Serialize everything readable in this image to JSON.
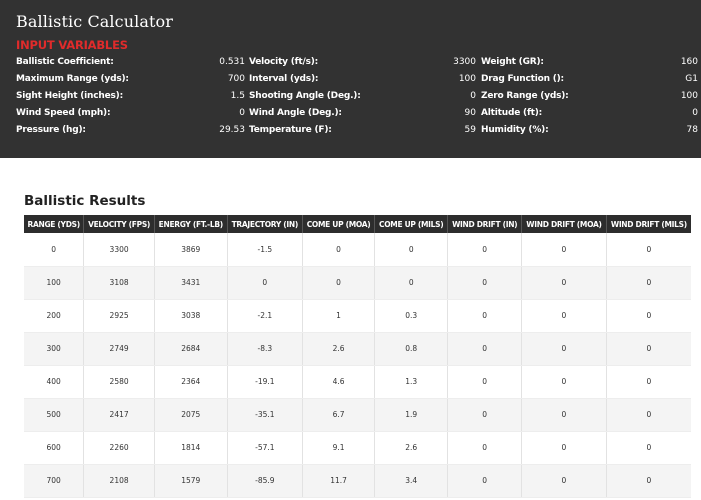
{
  "app": {
    "title": "Ballistic Calculator"
  },
  "inputs": {
    "section_title": "INPUT VARIABLES",
    "columns": [
      [
        {
          "label": "Ballistic Coefficient:",
          "value": "0.531"
        },
        {
          "label": "Maximum Range (yds):",
          "value": "700"
        },
        {
          "label": "Sight Height (inches):",
          "value": "1.5"
        },
        {
          "label": "Wind Speed (mph):",
          "value": "0"
        },
        {
          "label": "Pressure (hg):",
          "value": "29.53"
        }
      ],
      [
        {
          "label": "Velocity (ft/s):",
          "value": "3300"
        },
        {
          "label": "Interval (yds):",
          "value": "100"
        },
        {
          "label": "Shooting Angle (Deg.):",
          "value": "0"
        },
        {
          "label": "Wind Angle (Deg.):",
          "value": "90"
        },
        {
          "label": "Temperature (F):",
          "value": "59"
        }
      ],
      [
        {
          "label": "Weight (GR):",
          "value": "160"
        },
        {
          "label": "Drag Function ():",
          "value": "G1"
        },
        {
          "label": "Zero Range (yds):",
          "value": "100"
        },
        {
          "label": "Altitude (ft):",
          "value": "0"
        },
        {
          "label": "Humidity (%):",
          "value": "78"
        }
      ]
    ]
  },
  "results": {
    "title": "Ballistic Results",
    "headers": [
      "RANGE (YDS)",
      "VELOCITY (FPS)",
      "ENERGY (FT.-LB)",
      "TRAJECTORY (IN)",
      "COME UP (MOA)",
      "COME UP (MILS)",
      "WIND DRIFT (IN)",
      "WIND DRIFT (MOA)",
      "WIND DRIFT (MILS)"
    ],
    "rows": [
      [
        "0",
        "3300",
        "3869",
        "-1.5",
        "0",
        "0",
        "0",
        "0",
        "0"
      ],
      [
        "100",
        "3108",
        "3431",
        "0",
        "0",
        "0",
        "0",
        "0",
        "0"
      ],
      [
        "200",
        "2925",
        "3038",
        "-2.1",
        "1",
        "0.3",
        "0",
        "0",
        "0"
      ],
      [
        "300",
        "2749",
        "2684",
        "-8.3",
        "2.6",
        "0.8",
        "0",
        "0",
        "0"
      ],
      [
        "400",
        "2580",
        "2364",
        "-19.1",
        "4.6",
        "1.3",
        "0",
        "0",
        "0"
      ],
      [
        "500",
        "2417",
        "2075",
        "-35.1",
        "6.7",
        "1.9",
        "0",
        "0",
        "0"
      ],
      [
        "600",
        "2260",
        "1814",
        "-57.1",
        "9.1",
        "2.6",
        "0",
        "0",
        "0"
      ],
      [
        "700",
        "2108",
        "1579",
        "-85.9",
        "11.7",
        "3.4",
        "0",
        "0",
        "0"
      ]
    ]
  }
}
